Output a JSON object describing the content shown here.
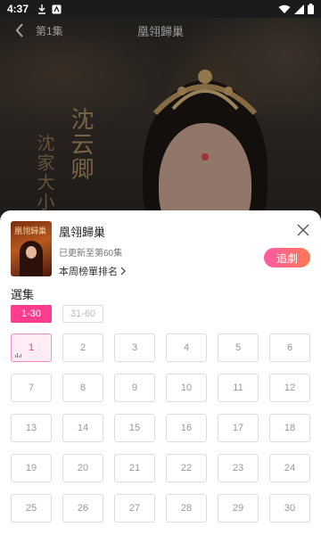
{
  "status_bar": {
    "time": "4:37",
    "icons": [
      "download-icon",
      "app-notification-icon",
      "wifi-icon",
      "signal-icon",
      "battery-icon"
    ]
  },
  "video": {
    "episode_label": "第1集",
    "drama_title": "凰翎歸巢",
    "calligraphy_main": "沈云卿",
    "calligraphy_sub": "沈家大小"
  },
  "sheet": {
    "title": "凰翎歸巢",
    "updated": "已更新至第60集",
    "rank": "本周榜單排名",
    "follow_label": "追劇",
    "section_title": "選集",
    "ranges": [
      {
        "label": "1-30",
        "active": true
      },
      {
        "label": "31-60",
        "active": false
      }
    ],
    "episodes": [
      "1",
      "2",
      "3",
      "4",
      "5",
      "6",
      "7",
      "8",
      "9",
      "10",
      "11",
      "12",
      "13",
      "14",
      "15",
      "16",
      "17",
      "18",
      "19",
      "20",
      "21",
      "22",
      "23",
      "24",
      "25",
      "26",
      "27",
      "28",
      "29",
      "30"
    ],
    "current_episode": "1",
    "accent_color": "#ff3d8f"
  }
}
